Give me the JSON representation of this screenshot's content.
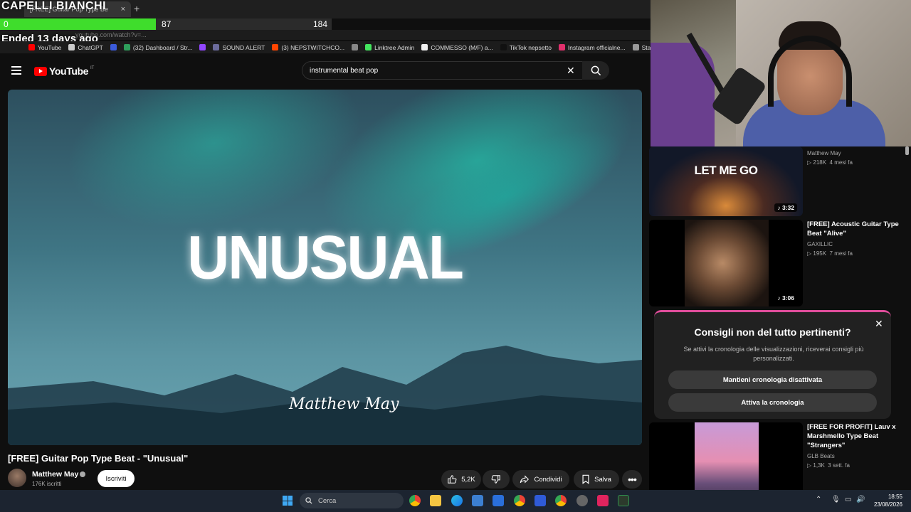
{
  "overlay": {
    "title": "CAPELLI BIANCHI",
    "progress_left": "0",
    "progress_mid": "87",
    "progress_right": "184",
    "progress_fraction": 0.47,
    "ended": "Ended 13 days ago"
  },
  "browser": {
    "tab_title": "[FREE] Guitar Pop Type Be",
    "url": "youtube.com/watch?v=...",
    "bookmarks": [
      {
        "label": "YouTube",
        "color": "#ff0000"
      },
      {
        "label": "ChatGPT",
        "color": "#cccccc"
      },
      {
        "label": "",
        "color": "#3b5bdb"
      },
      {
        "label": "(32) Dashboard / Str...",
        "color": "#2e9e5b"
      },
      {
        "label": "",
        "color": "#9146ff"
      },
      {
        "label": "SOUND ALERT",
        "color": "#6b6b9c"
      },
      {
        "label": "(3) NEPSTWITCHCO...",
        "color": "#ff4500"
      },
      {
        "label": "",
        "color": "#888888"
      },
      {
        "label": "Linktree Admin",
        "color": "#43e55e"
      },
      {
        "label": "COMMESSO (M/F) a...",
        "color": "#eeeeee"
      },
      {
        "label": "TikTok nepsetto",
        "color": "#111111"
      },
      {
        "label": "Instagram officialne...",
        "color": "#e1306c"
      },
      {
        "label": "StartHouse",
        "color": "#999999"
      }
    ]
  },
  "youtube": {
    "logo_text": "YouTube",
    "country": "IT",
    "search_value": "instrumental beat pop"
  },
  "video": {
    "big_word": "UNUSUAL",
    "signature": "Matthew May",
    "title": "[FREE] Guitar Pop Type Beat - \"Unusual\"",
    "channel": "Matthew May",
    "subscribers": "176K iscritti",
    "subscribe_label": "Iscriviti",
    "likes": "5,2K",
    "share_label": "Condividi",
    "save_label": "Salva"
  },
  "recommendations": [
    {
      "title": "",
      "channel": "Matthew May",
      "views": "218K",
      "age": "4 mesi fa",
      "duration": "3:32",
      "thumb_text": "LET ME GO"
    },
    {
      "title": "[FREE] Acoustic Guitar Type Beat \"Alive\"",
      "channel": "GAXILLIC",
      "views": "195K",
      "age": "7 mesi fa",
      "duration": "3:06",
      "thumb_text": ""
    },
    {
      "title": "[FREE FOR PROFIT] Lauv x Marshmello Type Beat \"Strangers\"",
      "channel": "GLB Beats",
      "views": "1,3K",
      "age": "3 sett. fa",
      "duration": "",
      "thumb_text": ""
    }
  ],
  "popup": {
    "title": "Consigli non del tutto pertinenti?",
    "body": "Se attivi la cronologia delle visualizzazioni, riceverai consigli più personalizzati.",
    "button1": "Mantieni cronologia disattivata",
    "button2": "Attiva la cronologia"
  },
  "taskbar": {
    "search": "Cerca",
    "time": "18:55",
    "date": "23/08/2026"
  }
}
